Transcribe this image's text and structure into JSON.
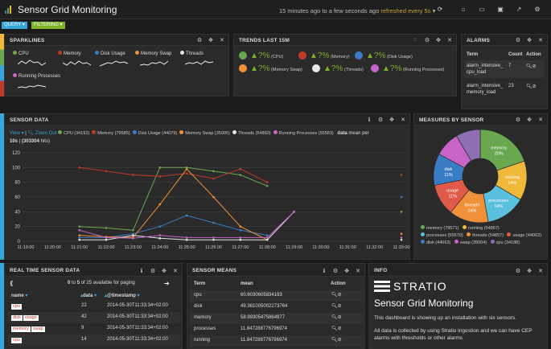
{
  "header": {
    "title": "Sensor Grid Monitoring",
    "time_text": "15 minutes ago to a few seconds ago",
    "refresh_text": "refreshed every 5s",
    "query_tab": "QUERY",
    "filtering_tab": "FILTERING"
  },
  "colors": {
    "cpu": "#6aa84f",
    "memory": "#c0392b",
    "disk": "#3b7dc4",
    "swap": "#f0913a",
    "threads": "#e8e8e8",
    "processes": "#c864c8",
    "running": "#f0b93a",
    "usage": "#e05a4a",
    "processes_pie": "#5bc0de"
  },
  "sparklines": {
    "title": "SPARKLINES",
    "items": [
      {
        "label": "CPU",
        "color": "#6aa84f"
      },
      {
        "label": "Memory",
        "color": "#c0392b"
      },
      {
        "label": "Disk Usage",
        "color": "#3b7dc4"
      },
      {
        "label": "Memory Swap",
        "color": "#f0913a"
      },
      {
        "label": "Threads",
        "color": "#e8e8e8"
      },
      {
        "label": "Running Processes",
        "color": "#c864c8"
      }
    ]
  },
  "trends": {
    "title": "TRENDS LAST 15M",
    "items": [
      {
        "value": "?%",
        "label": "(CPU)"
      },
      {
        "value": "?%",
        "label": "(Memory)"
      },
      {
        "value": "?%",
        "label": "(Disk Usage)"
      },
      {
        "value": "?%",
        "label": "(Memory Swap)"
      },
      {
        "value": "?%",
        "label": "(Threads)"
      },
      {
        "value": "?%",
        "label": "(Running Processes)"
      }
    ]
  },
  "alarms": {
    "title": "ALARMS",
    "columns": [
      "Term",
      "Count",
      "Action"
    ],
    "rows": [
      {
        "term_a": "alarm_intensive_",
        "term_b": "cpu_load",
        "count": "7"
      },
      {
        "term_a": "alarm_intensive_",
        "term_b": "memory_load",
        "count": "23"
      }
    ]
  },
  "sensor_data": {
    "title": "SENSOR DATA",
    "view": "View",
    "zoom_out": "Zoom Out",
    "legend": [
      {
        "label": "CPU (34192)",
        "color": "#6aa84f"
      },
      {
        "label": "Memory (79585)",
        "color": "#c0392b"
      },
      {
        "label": "Disk Usage (44079)",
        "color": "#3b7dc4"
      },
      {
        "label": "Memory Swap (35005)",
        "color": "#f0913a"
      },
      {
        "label": "Threads (54860)",
        "color": "#e8e8e8"
      },
      {
        "label": "Running Processes (55583)",
        "color": "#c864c8"
      }
    ],
    "data_label": "data",
    "data_suffix": "mean per",
    "interval": "10s",
    "hits": "(303304",
    "hits_suffix": "hits)"
  },
  "chart_data": {
    "type": "line",
    "x": [
      "11:19:00",
      "11:20:00",
      "11:21:00",
      "11:22:00",
      "11:23:00",
      "11:24:00",
      "11:25:00",
      "11:26:00",
      "11:27:00",
      "11:28:00",
      "11:29:00",
      "11:30:00",
      "11:31:00",
      "11:32:00",
      "11:33:00"
    ],
    "yticks": [
      0,
      20,
      40,
      60,
      80,
      100,
      120
    ],
    "ylim": [
      0,
      120
    ],
    "series": [
      {
        "name": "CPU",
        "color": "#6aa84f",
        "values": [
          null,
          null,
          20,
          18,
          15,
          100,
          100,
          95,
          90,
          75,
          null,
          null,
          null,
          null,
          40
        ]
      },
      {
        "name": "Memory",
        "color": "#c0392b",
        "values": [
          null,
          null,
          100,
          95,
          90,
          88,
          92,
          85,
          98,
          80,
          null,
          null,
          null,
          null,
          90
        ]
      },
      {
        "name": "Disk Usage",
        "color": "#3b7dc4",
        "values": [
          null,
          null,
          5,
          5,
          10,
          20,
          35,
          25,
          15,
          8,
          null,
          null,
          null,
          null,
          60
        ]
      },
      {
        "name": "Memory Swap",
        "color": "#f0913a",
        "values": [
          null,
          null,
          8,
          6,
          5,
          50,
          98,
          60,
          20,
          2,
          null,
          null,
          null,
          null,
          10
        ]
      },
      {
        "name": "Threads",
        "color": "#e8e8e8",
        "values": [
          null,
          null,
          2,
          2,
          8,
          4,
          2,
          2,
          2,
          2,
          40,
          null,
          null,
          null,
          2
        ]
      },
      {
        "name": "Running Processes",
        "color": "#c864c8",
        "values": [
          null,
          null,
          15,
          5,
          4,
          8,
          5,
          5,
          5,
          5,
          40,
          null,
          null,
          null,
          5
        ]
      }
    ]
  },
  "measures": {
    "title": "MEASURES BY SENSOR",
    "slices": [
      {
        "label": "memory",
        "pct": "20%",
        "value": 79571,
        "color": "#6aa84f"
      },
      {
        "label": "running",
        "pct": "14%",
        "value": 54857,
        "color": "#f0b93a"
      },
      {
        "label": "processes",
        "pct": "14%",
        "value": 55570,
        "color": "#5bc0de"
      },
      {
        "label": "threads",
        "pct": "14%",
        "value": 54857,
        "color": "#f0913a"
      },
      {
        "label": "usage",
        "pct": "11%",
        "value": 44063,
        "color": "#e05a4a"
      },
      {
        "label": "disk",
        "pct": "11%",
        "value": 44063,
        "color": "#3b7dc4"
      },
      {
        "label": "swap",
        "pct": "9%",
        "value": 35004,
        "color": "#c864c8"
      },
      {
        "label": "cpu",
        "pct": "9%",
        "value": 34188,
        "color": "#8e6fb3"
      }
    ],
    "legend": [
      "memory (79571)",
      "running (54857)",
      "processes (55570)",
      "threads (54857)",
      "usage (44063)",
      "disk (44063)",
      "swap (35004)",
      "cpu (34188)"
    ]
  },
  "realtime": {
    "title": "REAL TIME SENSOR DATA",
    "paging_from": "0",
    "paging_to": "5",
    "paging_total": "of 25 available for paging",
    "columns": [
      "name",
      "data",
      "@timestamp"
    ],
    "rows": [
      {
        "tags": [
          "cpu"
        ],
        "data": "22",
        "ts": "2014-05-30T11:33:34+02:00"
      },
      {
        "tags": [
          "disk",
          "usage"
        ],
        "data": "42",
        "ts": "2014-05-30T11:33:34+02:00"
      },
      {
        "tags": [
          "memory",
          "swap"
        ],
        "data": "9",
        "ts": "2014-05-30T11:33:34+02:00"
      },
      {
        "tags": [
          "cpu"
        ],
        "data": "14",
        "ts": "2014-05-30T11:33:34+02:00"
      }
    ]
  },
  "means": {
    "title": "SENSOR MEANS",
    "columns": [
      "Term",
      "mean",
      "Action"
    ],
    "rows": [
      {
        "term": "cpu",
        "mean": "60.6030605834193"
      },
      {
        "term": "disk",
        "mean": "49.361005002273764"
      },
      {
        "term": "memory",
        "mean": "58.99305475864977"
      },
      {
        "term": "processes",
        "mean": "11.847288776796974"
      },
      {
        "term": "running",
        "mean": "11.847288776796974"
      }
    ]
  },
  "info": {
    "title": "INFO",
    "brand": "STRATIO",
    "heading": "Sensor Grid Monitoring",
    "p1": "This dashboard is showing up an installation with six sensors.",
    "p2": "All data is collected by using Stratio Ingestion and we can have CEP alarms with thresholds or other alarms"
  }
}
